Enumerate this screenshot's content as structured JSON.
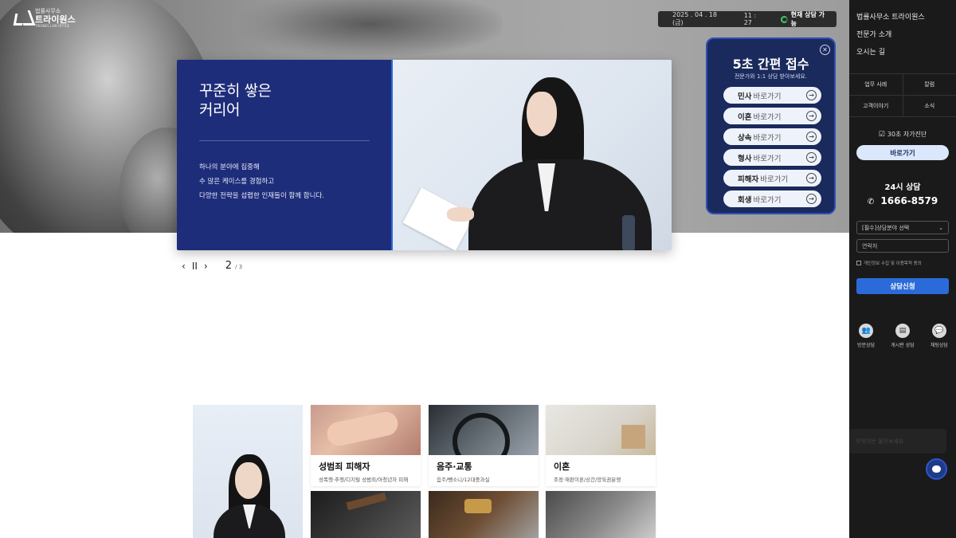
{
  "brand": {
    "small": "법률사무소",
    "name": "트라이원스",
    "eng": "TRIONES LAW OFFICE"
  },
  "datebar": {
    "date": "2025 . 04 . 18 (금)",
    "time": "11 : 27",
    "status": "현재 상담 가능"
  },
  "hero": {
    "title_line1": "꾸준히 쌓은",
    "title_line2": "커리어",
    "desc_line1": "하나의 분야에 집중해",
    "desc_line2": "수 많은 케이스를 경험하고",
    "desc_line3": "다양한 전략을 섭렵한 인재들이 함께 합니다."
  },
  "pager": {
    "prev": "‹",
    "pause": "II",
    "next": "›",
    "current": "2",
    "total": "/ 3"
  },
  "quick": {
    "title": "5초 간편 접수",
    "subtitle": "전문가와 1:1 상담 받아보세요.",
    "items": [
      {
        "name": "민사",
        "suffix": "바로가기"
      },
      {
        "name": "이혼",
        "suffix": "바로가기"
      },
      {
        "name": "상속",
        "suffix": "바로가기"
      },
      {
        "name": "형사",
        "suffix": "바로가기"
      },
      {
        "name": "피해자",
        "suffix": "바로가기"
      },
      {
        "name": "회생",
        "suffix": "바로가기"
      }
    ]
  },
  "sidebar": {
    "nav": [
      "법률사무소 트라이원스",
      "전문가 소개",
      "오시는 길"
    ],
    "tabs": [
      "업무 사례",
      "칼럼",
      "고객이야기",
      "소식"
    ],
    "self_check": "30초 자가진단",
    "go_button": "바로가기",
    "hours": "24시 상담",
    "phone": "1666-8579",
    "select_placeholder": "[필수]상담분야 선택",
    "contact_placeholder": "연락처",
    "agree": "개인정보 수집 및 이용목적 동의",
    "submit": "상담신청",
    "channels": [
      "방문상담",
      "게시판 상담",
      "채팅상담"
    ],
    "chat_hint": "무엇이든 물어보세요"
  },
  "practice": {
    "cards": [
      {
        "title": "성범죄 피해자",
        "sub": "성폭행·추행/디지털 성범죄/아청년자 피해"
      },
      {
        "title": "음주·교통",
        "sub": "음주/뺑소니/12대중과실"
      },
      {
        "title": "이혼",
        "sub": "조정·재판이혼/상간/양육권분쟁"
      }
    ]
  },
  "colors": {
    "hero_blue": "#1e2d7a",
    "quick_bg": "#1b2a5c",
    "submit_blue": "#2b6bd9",
    "sidebar_bg": "#1a1a1a"
  }
}
